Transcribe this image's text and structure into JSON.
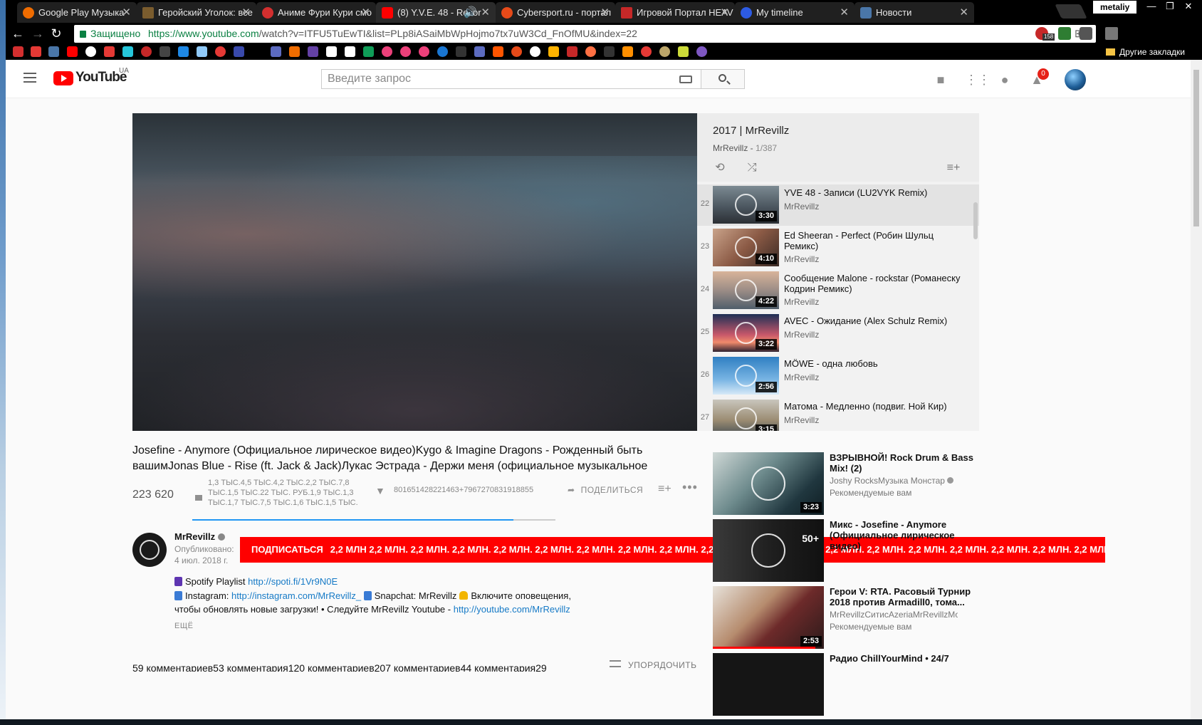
{
  "browser": {
    "tabs": [
      {
        "title": "Google Play Музыка",
        "active": false,
        "color": "#ef6c00"
      },
      {
        "title": "Геройский Уголок: все",
        "active": false,
        "color": "#7a5c2e"
      },
      {
        "title": "Аниме Фури Кури смо",
        "active": false,
        "color": "#d32f2f"
      },
      {
        "title": "(8) Y.V.E. 48 - Recor",
        "active": true,
        "color": "#f00"
      },
      {
        "title": "Cybersport.ru - портал",
        "active": false,
        "color": "#e64a19"
      },
      {
        "title": "Игровой Портал HEAV",
        "active": false,
        "color": "#c62828"
      },
      {
        "title": "My timeline",
        "active": false,
        "color": "#2d5be3"
      },
      {
        "title": "Новости",
        "active": false,
        "color": "#4a76a8"
      }
    ],
    "profile": "metaliy",
    "secure_label": "Защищено",
    "url_host": "https://www.youtube.com",
    "url_path": "/watch?v=ITFU5TuEwTI&list=PLp8iASaiMbWpHojmo7tx7uW3Cd_FnOfMU&index=22",
    "extension_badge": "158",
    "other_bookmarks": "Другие закладки"
  },
  "masthead": {
    "logo_text": "YouTube",
    "region": "UA",
    "search_placeholder": "Введите запрос",
    "notification_count": "0"
  },
  "playlist": {
    "title": "2017 | MrRevillz",
    "owner": "MrRevillz",
    "position": "1/387",
    "items": [
      {
        "index": "22",
        "title": "YVE 48 - Записи (LU2VYK Remix)",
        "channel": "MrRevillz",
        "duration": "3:30",
        "current": true
      },
      {
        "index": "23",
        "title": "Ed Sheeran - Perfect (Робин Шульц Ремикс)",
        "channel": "MrRevillz",
        "duration": "4:10",
        "current": false
      },
      {
        "index": "24",
        "title": "Сообщение Malone - rockstar (Романеску Кодрин Ремикс)",
        "channel": "MrRevillz",
        "duration": "4:22",
        "current": false
      },
      {
        "index": "25",
        "title": "AVEC - Ожидание (Alex Schulz Remix)",
        "channel": "MrRevillz",
        "duration": "3:22",
        "current": false
      },
      {
        "index": "26",
        "title": "MÖWE - одна любовь",
        "channel": "MrRevillz",
        "duration": "2:56",
        "current": false
      },
      {
        "index": "27",
        "title": "Матома - Медленно (подвиг. Ной Кир)",
        "channel": "MrRevillz",
        "duration": "3:15",
        "current": false
      }
    ]
  },
  "video": {
    "title": "Josefine - Anymore (Официальное лирическое видео)Kygo & Imagine Dragons - Рожденный быть вашимJonas Blue - Rise (ft. Jack & Jack)Лукас Эстрада - Держи меня (официальное музыкальное",
    "views": "223 620",
    "likes": "1,3 ТЫС.4,5 ТЫС.4,2 ТЫС.2,2 ТЫС.7,8 ТЫС.1,5 ТЫС.22 ТЫС. РУБ.1,9 ТЫС.1,3 ТЫС.1,7 ТЫС.7,5 ТЫС.1,6 ТЫС.1,5 ТЫС.",
    "dislikes": "801651428221463+7967270831918855",
    "share": "ПОДЕЛИТЬСЯ",
    "like_ratio": 0.885,
    "channel": "MrRevillz",
    "published_label": "Опубликовано:",
    "published_date": "4 июл. 2018 г.",
    "subscribe_label": "ПОДПИСАТЬСЯ",
    "subscriber_count": "2,2 МЛН 2,2 МЛН. 2,2 МЛН. 2,2 МЛН. 2,2 МЛН. 2,2 МЛН. 2,2 МЛН. 2,2 МЛН. 2,2 МЛН. 2,2 МЛН. 2,2 МЛН. 2,2 МЛН. 2,2 МЛН. 2,2 МЛН. 2,2 МЛН. 2,2 МЛН. 2,2 МЛН. 2,2 МЛН. 2,2 МЛН.",
    "desc": {
      "spotify_label": "Spotify Playlist",
      "spotify_link": "http://spoti.fi/1Vr9N0E",
      "instagram_label": "Instagram:",
      "instagram_link": "http://instagram.com/MrRevillz_",
      "snapchat": "Snapchat: MrRevillz",
      "notify": "Включите оповещения, чтобы обновлять новые загрузки! • Следуйте MrRevillz Youtube -",
      "youtube_link": "http://youtube.com/MrRevillz"
    },
    "show_more": "ЕЩЁ",
    "comments": "59 комментариев53 комментария120 комментариев207 комментариев44 комментария29",
    "sort": "УПОРЯДОЧИТЬ"
  },
  "recommended": [
    {
      "title": "ВЗРЫВНОЙ! Rock Drum & Bass Mix! (2)",
      "channel": "Joshy RocksМузыка Монстар",
      "meta": "Рекомендуемые вам",
      "duration": "3:23",
      "verified": true
    },
    {
      "title": "Микс - Josefine - Anymore (Официальное лирическое видео)",
      "channel": "",
      "meta": "",
      "duration": "50+",
      "verified": false
    },
    {
      "title": "Герои V: RTA. Расовый Турнир 2018 против Armadill0, тома...",
      "channel": "MrRevillzСитисAzeriaMrRevillzМоя",
      "meta": "Рекомендуемые вам",
      "duration": "2:53",
      "verified": false,
      "progress": 0.92
    },
    {
      "title": "Радио ChillYourMind • 24/7",
      "channel": "",
      "meta": "",
      "duration": "",
      "verified": false
    }
  ]
}
